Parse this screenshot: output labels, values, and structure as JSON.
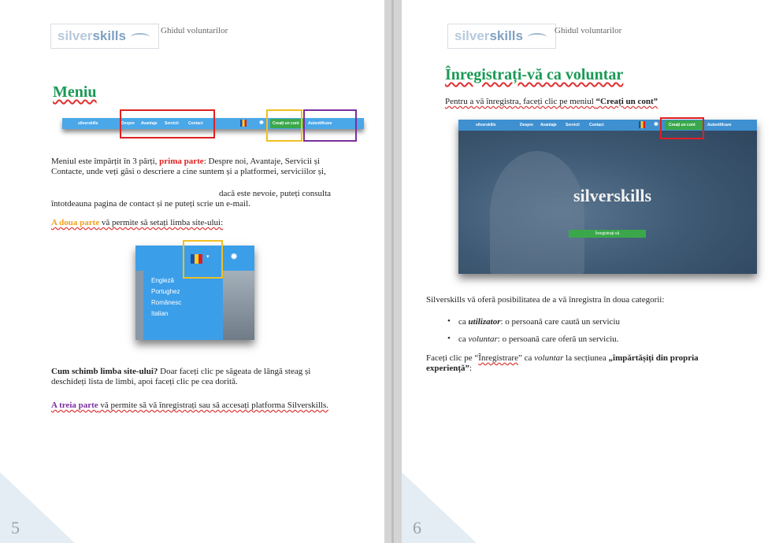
{
  "left_page": {
    "header": "Ghidul voluntarilor",
    "logo": {
      "part1": "silver",
      "part2": "skills"
    },
    "title": "Meniu",
    "menubar": {
      "brand": "silverskills",
      "items": [
        "Despre",
        "Avantaje",
        "Servicii",
        "Contact"
      ],
      "create_account": "Creați un cont",
      "login": "Autentificare"
    },
    "para1": {
      "a": "Meniul este împărțit în 3 părți, ",
      "b": "prima parte",
      "c": ": Despre noi, Avantaje, Servicii și",
      "line2": "Contacte, unde veți găsi o descriere a cine suntem și a platformei, serviciilor și,",
      "line3": "dacă este nevoie, puteți consulta",
      "line4": "întotdeauna pagina de contact și ne puteți scrie un e-mail."
    },
    "para2": {
      "a": "A doua parte",
      "b": " vă permite să setați limba site-ului:"
    },
    "languages": [
      "Engleză",
      "Portughez",
      "Românesc",
      "Italian"
    ],
    "para3": {
      "a": "Cum schimb limba site-ului?",
      "b": " Doar faceți clic pe săgeata de lângă steag și",
      "line2": "deschideți lista de limbi, apoi faceți clic pe cea dorită."
    },
    "para4": {
      "a": "A treia parte",
      "b": " vă permite să vă înregistrați sau să accesați platforma Silverskills."
    },
    "page_number": "5"
  },
  "right_page": {
    "header": "Ghidul voluntarilor",
    "logo": {
      "part1": "silver",
      "part2": "skills"
    },
    "title": "Înregistrați-vă ca voluntar",
    "intro": {
      "a": "Pentru a vă înregistra, faceți clic pe meniul ",
      "b": "“Creați un cont”"
    },
    "hero": {
      "brand": "silverskills",
      "items": [
        "Despre",
        "Avantaje",
        "Servicii",
        "Contact"
      ],
      "create_account": "Creați un cont",
      "login": "Autentificare",
      "title": "silverskills",
      "button": "Înregistrați-vă"
    },
    "categories_intro": "Silverskills vă oferă posibilitatea de a vă înregistra în doua categorii:",
    "categories": [
      {
        "pre": "ca ",
        "term": "utilizator",
        "post": ": o persoană care caută un serviciu"
      },
      {
        "pre": "ca ",
        "term": "voluntar",
        "post": ": o persoană care oferă un serviciu."
      }
    ],
    "final": {
      "a": "Faceți clic pe “",
      "b": "Înregistrare",
      "c": "” ca ",
      "d": "voluntar",
      "e": " la secțiunea ",
      "f": "„împărtășiți din propria",
      "line2": "experiență”",
      "line2_end": ":"
    },
    "page_number": "6"
  },
  "colors": {
    "heading": "#1a9a55",
    "menu_blue": "#4aa7e8",
    "highlight_red": "#e02020",
    "highlight_orange": "#f0c020",
    "highlight_purple": "#7a2fa0",
    "green_button": "#3aa84a"
  }
}
